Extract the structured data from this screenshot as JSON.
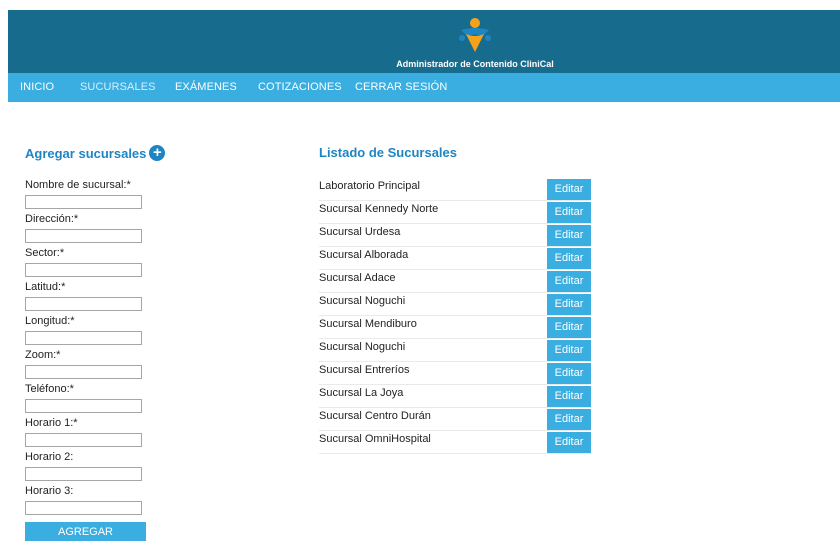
{
  "header": {
    "title": "Administrador de Contenido CliniCal",
    "logo_icon": "clinical-logo-icon"
  },
  "nav": {
    "items": [
      {
        "label": "INICIO"
      },
      {
        "label": "SUCURSALES"
      },
      {
        "label": "EXÁMENES"
      },
      {
        "label": "COTIZACIONES"
      },
      {
        "label": "CERRAR SESIÓN"
      }
    ],
    "active": "SUCURSALES"
  },
  "form": {
    "title": "Agregar sucursales",
    "fields": [
      {
        "label": "Nombre de sucursal:*",
        "value": ""
      },
      {
        "label": "Dirección:*",
        "value": ""
      },
      {
        "label": "Sector:*",
        "value": ""
      },
      {
        "label": "Latitud:*",
        "value": ""
      },
      {
        "label": "Longitud:*",
        "value": ""
      },
      {
        "label": "Zoom:*",
        "value": ""
      },
      {
        "label": "Teléfono:*",
        "value": ""
      },
      {
        "label": "Horario 1:*",
        "value": ""
      },
      {
        "label": "Horario 2:",
        "value": ""
      },
      {
        "label": "Horario 3:",
        "value": ""
      }
    ],
    "submit_label": "AGREGAR"
  },
  "list": {
    "title": "Listado de Sucursales",
    "edit_label": "Editar",
    "items": [
      "Laboratorio Principal",
      "Sucursal Kennedy Norte",
      "Sucursal Urdesa",
      "Sucursal Alborada",
      "Sucursal Adace",
      "Sucursal Noguchi",
      "Sucursal Mendiburo",
      "Sucursal Noguchi",
      "Sucursal Entreríos",
      "Sucursal La Joya",
      "Sucursal Centro Durán",
      "Sucursal OmniHospital"
    ]
  },
  "colors": {
    "header_bg": "#176b8c",
    "nav_bg": "#3aaee0",
    "accent": "#1e85c4",
    "logo_orange": "#f5a21b"
  }
}
